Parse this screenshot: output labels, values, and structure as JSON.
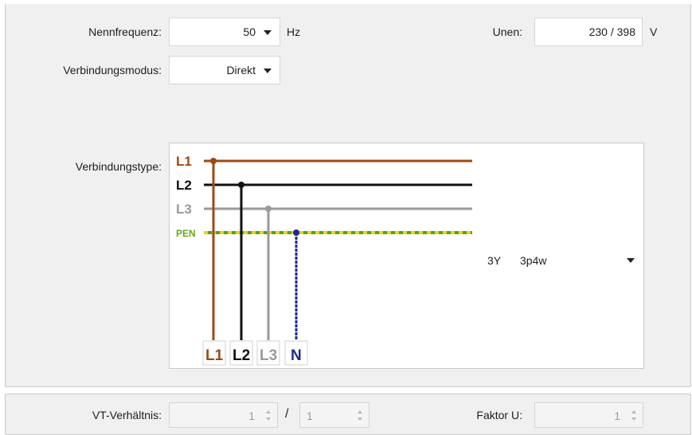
{
  "top": {
    "nennfrequenz_label": "Nennfrequenz:",
    "nennfrequenz_value": "50",
    "nennfrequenz_unit": "Hz",
    "unen_label": "Unen:",
    "unen_value": "230 / 398",
    "unen_unit": "V",
    "verbindungsmodus_label": "Verbindungsmodus:",
    "verbindungsmodus_value": "Direkt",
    "verbindungstype_label": "Verbindungstype:"
  },
  "diagram": {
    "wires_left": [
      "L1",
      "L2",
      "L3",
      "PEN"
    ],
    "wires_bottom": [
      "L1",
      "L2",
      "L3",
      "N"
    ],
    "type_code": "3Y",
    "type_name": "3p4w",
    "colors": {
      "l1": "#9c4a12",
      "l2": "#111111",
      "l3": "#9a9a9a",
      "pen_green": "#5a9e1e",
      "pen_yellow": "#e8d21c",
      "n": "#1c2c8c"
    }
  },
  "bottom": {
    "vt_label": "VT-Verhältnis:",
    "vt_primary": "1",
    "vt_separator": "/",
    "vt_secondary": "1",
    "faktor_label": "Faktor U:",
    "faktor_value": "1"
  }
}
